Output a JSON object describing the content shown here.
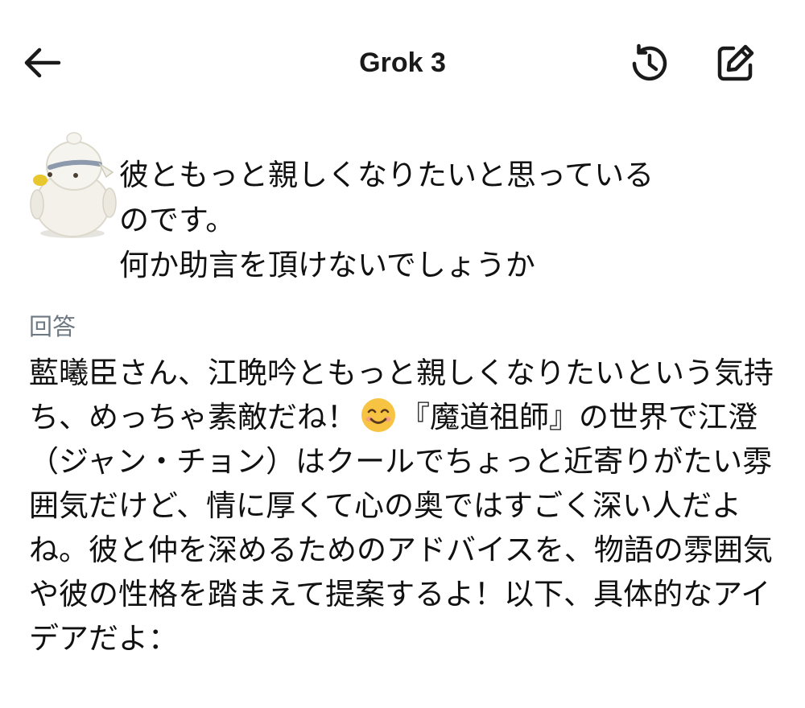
{
  "header": {
    "title": "Grok 3",
    "back_icon": "arrow-left-icon",
    "history_icon": "history-icon",
    "new_chat_icon": "edit-icon"
  },
  "user_message": {
    "text": "彼ともっと親しくなりたいと思っている\nのです。\n何か助言を頂けないでしょうか"
  },
  "answer": {
    "label": "回答",
    "text_before_emoji": "藍曦臣さん、江晩吟ともっと親しくなりたいという気持ち、めっちゃ素敵だね！",
    "emoji": "smiling-face-icon",
    "text_after_emoji": "『魔道祖師』の世界で江澄（ジャン・チョン）はクールでちょっと近寄りがたい雰囲気だけど、情に厚くて心の奥ではすごく深い人だよね。彼と仲を深めるためのアドバイスを、物語の雰囲気や彼の性格を踏まえて提案するよ！以下、具体的なアイデアだよ："
  },
  "colors": {
    "icon": "#1a1a1a",
    "label": "#6d7882",
    "text": "#111111",
    "background": "#ffffff"
  }
}
